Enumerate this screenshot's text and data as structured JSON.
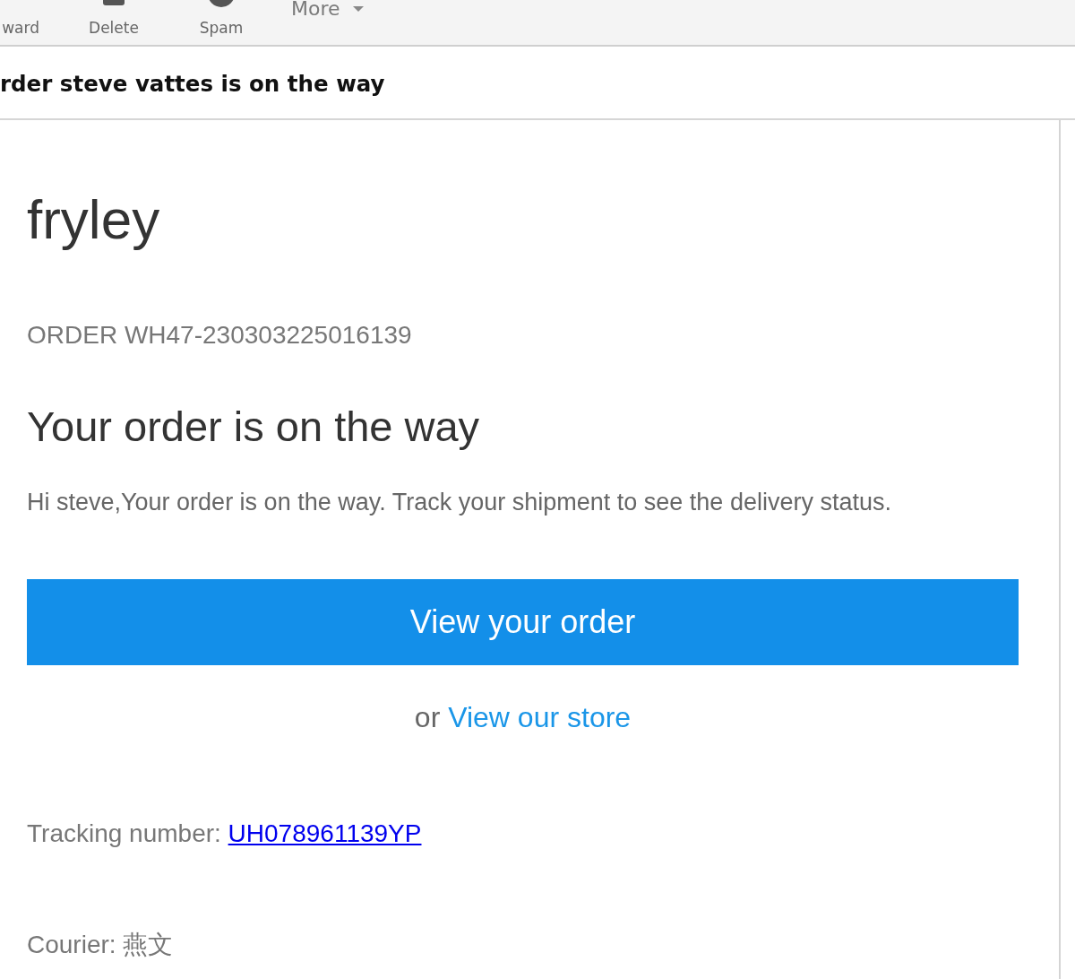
{
  "toolbar": {
    "buttons": [
      {
        "kind": "forward",
        "label": "ward"
      },
      {
        "kind": "delete",
        "label": "Delete"
      },
      {
        "kind": "spam",
        "label": "Spam"
      }
    ],
    "more": {
      "label": "More"
    }
  },
  "subject": "rder steve vattes is on the way",
  "email": {
    "brand": "fryley",
    "order_number": "ORDER WH47-230303225016139",
    "heading": "Your order is on the way",
    "message": "Hi steve,Your order is on the way. Track your shipment to see the delivery status.",
    "primary_button": "View your order",
    "secondary": {
      "prefix": "or",
      "link": "View our store"
    },
    "tracking": {
      "label": "Tracking number:",
      "link": "UH078961139YP"
    },
    "courier": "Courier: 燕文"
  }
}
